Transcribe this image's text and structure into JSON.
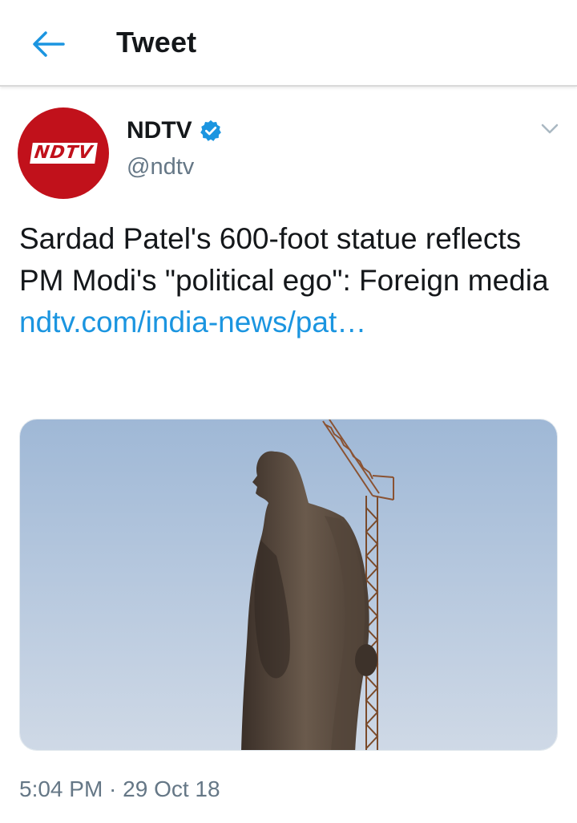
{
  "header": {
    "back_icon": "arrow-left-icon",
    "title": "Tweet"
  },
  "tweet": {
    "avatar_text": "NDTV",
    "author_name": "NDTV",
    "verified_icon": "verified-badge-icon",
    "handle": "@ndtv",
    "menu_icon": "chevron-down-icon",
    "text": "Sardad Patel's 600-foot statue reflects PM Modi's \"political ego\": Foreign media ",
    "link_text": "ndtv.com/india-news/pat…",
    "media_icon": "photo",
    "time": "5:04 PM",
    "separator": " · ",
    "date": "29 Oct 18"
  },
  "colors": {
    "accent": "#1b95e0",
    "brand_red": "#c1111b",
    "text_primary": "#14171a",
    "text_secondary": "#657786"
  }
}
